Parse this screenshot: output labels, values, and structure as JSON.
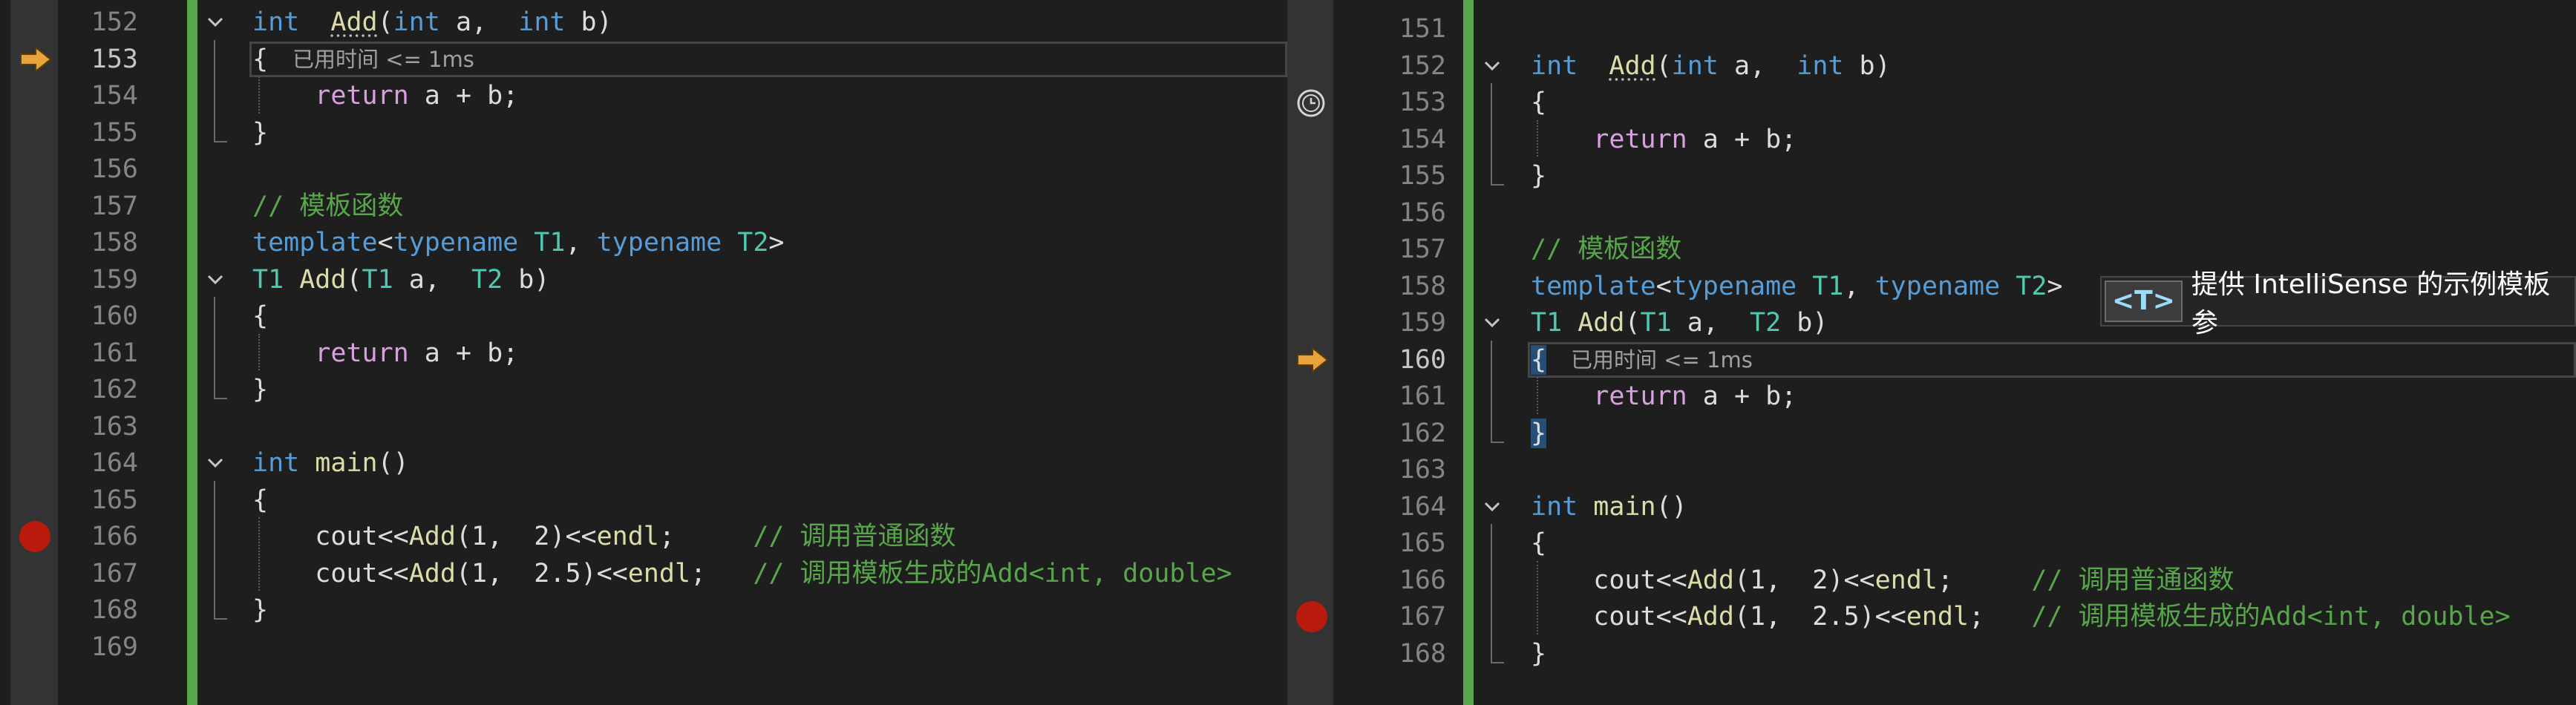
{
  "left_pane": {
    "lines": [
      {
        "num": "152",
        "tokens": [
          [
            "kw",
            "int"
          ],
          [
            "",
            "  "
          ],
          [
            "fn squig",
            "Add"
          ],
          [
            "",
            "("
          ],
          [
            "kw",
            "int"
          ],
          [
            "",
            " a,  "
          ],
          [
            "kw",
            "int"
          ],
          [
            "",
            " b)"
          ]
        ],
        "fold": true
      },
      {
        "num": "153",
        "tokens": [
          [
            "",
            "{"
          ]
        ],
        "current": true
      },
      {
        "num": "154",
        "tokens": [
          [
            "",
            "    "
          ],
          [
            "ctl",
            "return"
          ],
          [
            "",
            " a + b;"
          ]
        ]
      },
      {
        "num": "155",
        "tokens": [
          [
            "",
            "}"
          ]
        ]
      },
      {
        "num": "156",
        "tokens": []
      },
      {
        "num": "157",
        "tokens": [
          [
            "cm",
            "// 模板函数"
          ]
        ]
      },
      {
        "num": "158",
        "tokens": [
          [
            "kw",
            "template"
          ],
          [
            "",
            "<"
          ],
          [
            "kw",
            "typename"
          ],
          [
            "",
            ""
          ],
          [
            "ty",
            " T1"
          ],
          [
            "",
            ", "
          ],
          [
            "kw",
            "typename"
          ],
          [
            "ty",
            " T2"
          ],
          [
            "",
            ">"
          ]
        ]
      },
      {
        "num": "159",
        "tokens": [
          [
            "ty",
            "T1"
          ],
          [
            "fn",
            " Add"
          ],
          [
            "",
            "("
          ],
          [
            "ty",
            "T1"
          ],
          [
            "",
            " a,  "
          ],
          [
            "ty",
            "T2"
          ],
          [
            "",
            " b)"
          ]
        ],
        "fold": true
      },
      {
        "num": "160",
        "tokens": [
          [
            "",
            "{"
          ]
        ]
      },
      {
        "num": "161",
        "tokens": [
          [
            "",
            "    "
          ],
          [
            "ctl",
            "return"
          ],
          [
            "",
            " a + b;"
          ]
        ]
      },
      {
        "num": "162",
        "tokens": [
          [
            "",
            "}"
          ]
        ]
      },
      {
        "num": "163",
        "tokens": []
      },
      {
        "num": "164",
        "tokens": [
          [
            "kw",
            "int"
          ],
          [
            "fn",
            " main"
          ],
          [
            "",
            "()"
          ]
        ],
        "fold": true
      },
      {
        "num": "165",
        "tokens": [
          [
            "",
            "{"
          ]
        ]
      },
      {
        "num": "166",
        "tokens": [
          [
            "",
            "    cout<<"
          ],
          [
            "fn",
            "Add"
          ],
          [
            "",
            "(1,  2)<<"
          ],
          [
            "fn",
            "endl"
          ],
          [
            "",
            ";     "
          ],
          [
            "cm",
            "// 调用普通函数"
          ]
        ],
        "breakpoint": true
      },
      {
        "num": "167",
        "tokens": [
          [
            "",
            "    cout<<"
          ],
          [
            "fn",
            "Add"
          ],
          [
            "",
            "(1,  2.5)<<"
          ],
          [
            "fn",
            "endl"
          ],
          [
            "",
            ";   "
          ],
          [
            "cm",
            "// 调用模板生成的Add<int, double>"
          ]
        ]
      },
      {
        "num": "168",
        "tokens": [
          [
            "",
            "}"
          ]
        ]
      },
      {
        "num": "169",
        "tokens": []
      }
    ],
    "elapsed": "已用时间 <= 1ms"
  },
  "right_pane": {
    "lines": [
      {
        "num": "151",
        "tokens": []
      },
      {
        "num": "152",
        "tokens": [
          [
            "kw",
            "int"
          ],
          [
            "",
            "  "
          ],
          [
            "fn squig",
            "Add"
          ],
          [
            "",
            "("
          ],
          [
            "kw",
            "int"
          ],
          [
            "",
            " a,  "
          ],
          [
            "kw",
            "int"
          ],
          [
            "",
            " b)"
          ]
        ],
        "fold": true
      },
      {
        "num": "153",
        "tokens": [
          [
            "",
            "{"
          ]
        ]
      },
      {
        "num": "154",
        "tokens": [
          [
            "",
            "    "
          ],
          [
            "ctl",
            "return"
          ],
          [
            "",
            " a + b;"
          ]
        ]
      },
      {
        "num": "155",
        "tokens": [
          [
            "",
            "}"
          ]
        ]
      },
      {
        "num": "156",
        "tokens": []
      },
      {
        "num": "157",
        "tokens": [
          [
            "cm",
            "// 模板函数"
          ]
        ]
      },
      {
        "num": "158",
        "tokens": [
          [
            "kw",
            "template"
          ],
          [
            "",
            "<"
          ],
          [
            "kw",
            "typename"
          ],
          [
            "ty",
            " T1"
          ],
          [
            "",
            ", "
          ],
          [
            "kw",
            "typename"
          ],
          [
            "ty",
            " T2"
          ],
          [
            "",
            ">"
          ]
        ]
      },
      {
        "num": "159",
        "tokens": [
          [
            "ty",
            "T1"
          ],
          [
            "fn",
            " Add"
          ],
          [
            "",
            "("
          ],
          [
            "ty",
            "T1"
          ],
          [
            "",
            " a,  "
          ],
          [
            "ty",
            "T2"
          ],
          [
            "",
            " b)"
          ]
        ],
        "fold": true
      },
      {
        "num": "160",
        "tokens": [
          [
            "brace-hl",
            "{"
          ]
        ],
        "current": true
      },
      {
        "num": "161",
        "tokens": [
          [
            "",
            "    "
          ],
          [
            "ctl",
            "return"
          ],
          [
            "",
            " a + b;"
          ]
        ]
      },
      {
        "num": "162",
        "tokens": [
          [
            "brace-hl",
            "}"
          ]
        ]
      },
      {
        "num": "163",
        "tokens": []
      },
      {
        "num": "164",
        "tokens": [
          [
            "kw",
            "int"
          ],
          [
            "fn",
            " main"
          ],
          [
            "",
            "()"
          ]
        ],
        "fold": true
      },
      {
        "num": "165",
        "tokens": [
          [
            "",
            "{"
          ]
        ]
      },
      {
        "num": "166",
        "tokens": [
          [
            "",
            "    cout<<"
          ],
          [
            "fn",
            "Add"
          ],
          [
            "",
            "(1,  2)<<"
          ],
          [
            "fn",
            "endl"
          ],
          [
            "",
            ";     "
          ],
          [
            "cm",
            "// 调用普通函数"
          ]
        ]
      },
      {
        "num": "167",
        "tokens": [
          [
            "",
            "    cout<<"
          ],
          [
            "fn",
            "Add"
          ],
          [
            "",
            "(1,  2.5)<<"
          ],
          [
            "fn",
            "endl"
          ],
          [
            "",
            ";   "
          ],
          [
            "cm",
            "// 调用模板生成的Add<int, double>"
          ]
        ],
        "breakpoint": true
      },
      {
        "num": "168",
        "tokens": [
          [
            "",
            "}"
          ]
        ]
      }
    ],
    "elapsed": "已用时间 <= 1ms",
    "tooltip": {
      "badge": "<T>",
      "text": "提供 IntelliSense 的示例模板参"
    }
  },
  "icons": {
    "execution_arrow": "arrow-right-icon",
    "breakpoint": "breakpoint-icon",
    "fold": "chevron-down-icon",
    "history": "clock-icon"
  },
  "colors": {
    "keyword": "#569cd6",
    "function": "#dcdcaa",
    "type": "#4ec9b0",
    "control": "#d8a0df",
    "comment": "#57a64a",
    "change_bar": "#57a64a",
    "breakpoint": "#e51400",
    "arrow": "#e8a33d"
  }
}
